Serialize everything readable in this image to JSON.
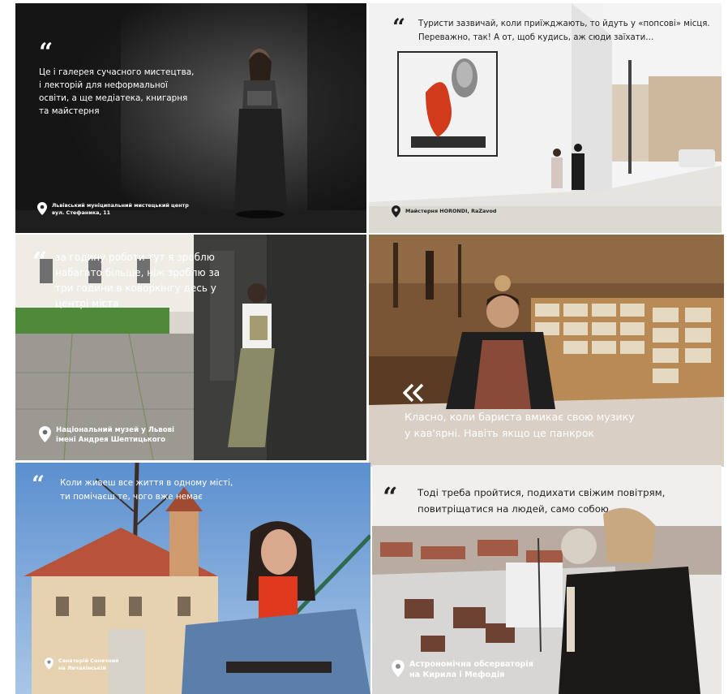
{
  "tiles": [
    {
      "quote": "Це і галерея сучасного мистецтва,\nі лекторій для неформальної\nосвіти, а ще медіатека, книгарня\nта майстерня",
      "location": "Львівський муніципальний мистецький центр\nвул. Стефаника, 11"
    },
    {
      "quote": "Туристи зазвичай, коли приїжджають, то йдуть у «попсові» місця.\nПереважно, так! А от, щоб кудись, аж сюди заїхати…",
      "location": "Майстерня HORONDI, RaZavod"
    },
    {
      "quote": "за годину роботи тут я зроблю\nнабагато більше, ніж зроблю за\nтри години в коворкінгу десь у\nцентрі міста",
      "location": "Національний музей у Львові\nімені Андрея Шептицького"
    },
    {
      "quote": "Класно, коли бариста вмикає свою музику\nу кав'ярні. Навіть якщо це панкрок",
      "location": ""
    },
    {
      "quote": "Коли живеш все життя в одному місті,\nти помічаєш те, чого вже немає",
      "location": "Санаторій Сонячний\nна Личаківській"
    },
    {
      "quote": "Тоді треба пройтися, подихати свіжим повітрям,\nповитріщатися на людей, само собою",
      "location": "Астрономічна обсерваторія\nна Кирила і Мефодія"
    }
  ],
  "icons": {
    "quote": "quote-icon",
    "location": "location-pin-icon",
    "chevron": "chevron-left-icon"
  },
  "colors": {
    "text": "#ffffff",
    "text_dark": "#1f1f1f"
  }
}
